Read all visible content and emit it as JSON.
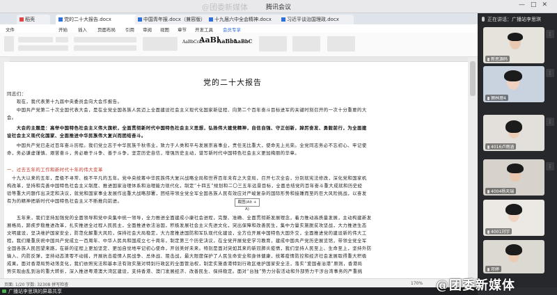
{
  "window": {
    "title": "腾讯会议",
    "watermark_top": "@团委新媒体"
  },
  "tabs": [
    {
      "label": "稻壳"
    },
    {
      "label": "党的二十大报告.docx"
    },
    {
      "label": "中国青年报.docx（兼容版）"
    },
    {
      "label": "十九届六中全会精神.docx"
    },
    {
      "label": "习近平谈治国理政.docx"
    }
  ],
  "menu": [
    "文件",
    "开始",
    "插入",
    "页面布局",
    "引用",
    "审阅",
    "视图",
    "章节",
    "开发工具",
    "会员专享"
  ],
  "ribbon_styles": [
    {
      "text": "AaBbCcD"
    },
    {
      "text": "AaBl"
    },
    {
      "text": "AaBbt"
    },
    {
      "text": "AaBbC"
    }
  ],
  "document": {
    "title": "党的二十大报告",
    "paragraphs": [
      {
        "text": "同志们："
      },
      {
        "text": "　　现在，我代表第十九届中央委员会向大会作报告。"
      },
      {
        "text": "　　中国共产党第二十次全国代表大会，是在全党全国各族人民迈上全面建设社会主义现代化国家新征程、向第二个百年奋斗目标进军的关键时刻召开的一次十分重要的大\n会。"
      },
      {
        "text": "　　大会的主题是：高举中国特色社会主义伟大旗帜，全面贯彻新时代中国特色社会主义思想，弘扬伟大建党精神，自信自强、守正创新，踔厉奋发、勇毅前行，为全面建\n设社会主义现代化国家、全面推进中华民族伟大复兴而团结奋斗。"
      },
      {
        "text": "　　中国共产党已走过百年奋斗历程。我们党立志于中华民族千秋伟业，致力于人类和平与发展崇高事业，责任无比重大，使命无上光荣。全党同志务必不忘初心、牢记使\n命，务必谦虚谨慎、艰苦奋斗，务必敢于斗争、善于斗争，坚定历史自信，增强历史主动，谱写新时代中国特色社会主义更加绚丽的华章。"
      },
      {
        "text": "一、过去五年的工作和新时代十年的伟大变革"
      },
      {
        "text": "　十九大以来的五年，是极不寻常、极不平凡的五年。党中央统筹中华民族伟大复兴战略全局和世界百年未有之大变局，召开七次全会，分别就宪法修改，深化党和国家机\n构改革，坚持和完善中国特色社会主义制度、推进国家治理体系和治理能力现代化，制定“十四五”规划和二〇三五年远景目标，全面总结党的百年奋斗重大成就和历史经\n验等重大问题作出决定和决议，就党和国家事业发展作出重大战略部署，团结带领全党全军全国各族人民有效应对严峻复杂的国际形势和接踵而至的巨大风险挑战，以奋发\n有为的精神把新时代中国特色社会主义不断推向前进。"
      },
      {
        "text": "　　五年来，我们坚持加强党的全面领导和党中央集中统一领导，全力推进全面建成小康社会进程，完整、准确、全面贯彻新发展理念，着力推动高质量发展，主动构建新发\n展格局，蹄疾步稳推进改革，扎实推进全过程人民民主，全面推进依法治国，积极发展社会主义先进文化，突出保障和改善民生，集中力量实施脱贫攻坚战，大力推进生态\n文明建设，坚决维护国家安全，防范化解重大风险，保持社会大局稳定，大力度推进国防和军队现代化建设，全方位开展中国特色大国外交，全面推进党的建设新的伟大工\n程。我们隆重庆祝中国共产党成立一百周年、中华人民共和国成立七十周年，制定第三个历史决议，在全党开展党史学习教育，建成中国共产党历史展览馆，带领全党全军\n全国各族人民回望来路，在新的征程上更加坚定、更加自觉地牢记初心使命，开创美好未来。特别是面对突如其来的新冠肺炎疫情，我们坚持人民至上、生命至上，坚持外防\n输入、内防反弹，坚持动态清零不动摇，开展抗击疫情人民战争、总体战、阻击战，最大限度保护了人民生命安全和身体健康，统筹疫情防控和经济社会发展取得重大积极\n成果。面对香港局势动荡变化，我们依照宪法和基本法有效实施对特别行政区的全面管治权，制定实施香港特别行政区维护国家安全法，落实“爱国者治港”原则，香港局\n势实现由乱到治的重大转折，深入推进粤港澳大湾区建设，支持香港、澳门发展经济、改善民生、保持稳定。面对“台独”势力分裂活动和外部势力干涉台湾事务的严重挑"
      }
    ],
    "tooltip": "截图(Alt + A)"
  },
  "statusbar": {
    "left": "页面: 1/20  字数: 32308  拼写检查",
    "right": "170%"
  },
  "meeting": {
    "speaking": "正在讲话：广播站李思琪",
    "screen_share_label": "广播站李思琪的屏幕共享",
    "watermark": "@团委新媒体",
    "participants": [
      {
        "name": "新思源码"
      },
      {
        "name": "狮林理4"
      },
      {
        "name": "4016卢雨涵"
      },
      {
        "name": "4004杨天瑞"
      },
      {
        "name": "4001刘宇"
      },
      {
        "name": "邓婷"
      }
    ]
  }
}
